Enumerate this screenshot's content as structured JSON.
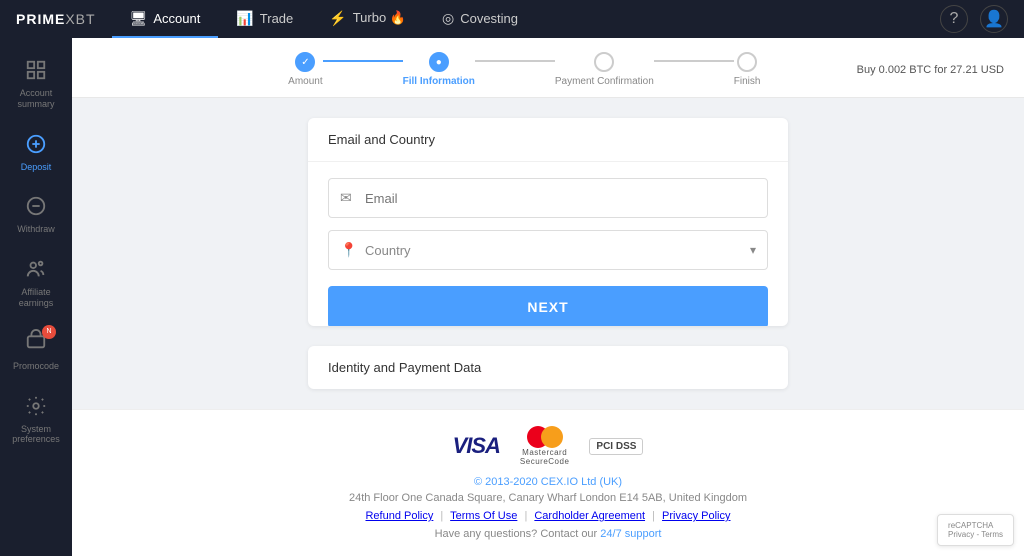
{
  "app": {
    "logo_prime": "PRIME",
    "logo_xbt": " XBT"
  },
  "top_nav": {
    "tabs": [
      {
        "id": "account",
        "label": "Account",
        "icon": "🖥",
        "active": true
      },
      {
        "id": "trade",
        "label": "Trade",
        "icon": "📊",
        "active": false
      },
      {
        "id": "turbo",
        "label": "Turbo 🔥",
        "icon": "⚡",
        "active": false
      },
      {
        "id": "covesting",
        "label": "Covesting",
        "icon": "◎",
        "active": false
      }
    ],
    "help_icon": "?",
    "user_icon": "👤"
  },
  "sidebar": {
    "items": [
      {
        "id": "account-summary",
        "label": "Account\nsummary",
        "icon": "grid",
        "active": false
      },
      {
        "id": "deposit",
        "label": "Deposit",
        "icon": "deposit",
        "active": true
      },
      {
        "id": "withdraw",
        "label": "Withdraw",
        "icon": "withdraw",
        "active": false
      },
      {
        "id": "affiliate-earnings",
        "label": "Affiliate\nearnings",
        "icon": "affiliate",
        "active": false
      },
      {
        "id": "promocode",
        "label": "Promocode",
        "icon": "promo",
        "active": false,
        "badge": "new"
      },
      {
        "id": "system-preferences",
        "label": "System\npreferences",
        "icon": "settings",
        "active": false
      }
    ]
  },
  "progress": {
    "steps": [
      {
        "id": "amount",
        "label": "Amount",
        "state": "completed"
      },
      {
        "id": "fill-information",
        "label": "Fill Information",
        "state": "active"
      },
      {
        "id": "payment-confirmation",
        "label": "Payment Confirmation",
        "state": "pending"
      },
      {
        "id": "finish",
        "label": "Finish",
        "state": "pending"
      }
    ],
    "buy_info": "Buy 0.002 BTC for 27.21 USD"
  },
  "form": {
    "section_title": "Email and Country",
    "email_placeholder": "Email",
    "country_placeholder": "Country",
    "next_button": "NEXT"
  },
  "identity_section": {
    "title": "Identity and Payment Data"
  },
  "footer": {
    "copyright": "© 2013-2020 CEX.IO Ltd (UK)",
    "address": "24th Floor One Canada Square, Canary Wharf London E14 5AB, United Kingdom",
    "links": [
      "Refund Policy",
      "Terms Of Use",
      "Cardholder Agreement",
      "Privacy Policy"
    ],
    "support_text": "Have any questions? Contact our",
    "support_link": "24/7 support"
  }
}
